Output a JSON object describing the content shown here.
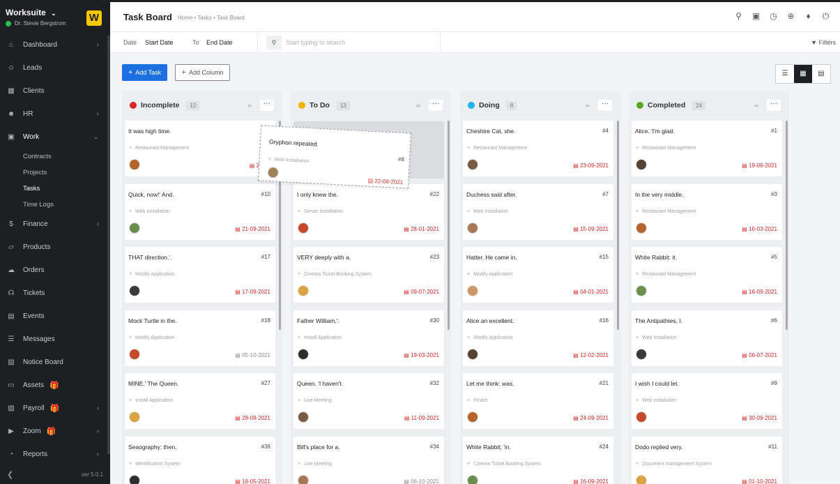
{
  "app": {
    "name": "Worksuite",
    "user": "Dr. Stevie Bergstrom",
    "logo_letter": "W",
    "version": "ver 5.0.1"
  },
  "sidebar": {
    "items": [
      {
        "label": "Dashboard",
        "icon": "home-icon",
        "has_chevron": true
      },
      {
        "label": "Leads",
        "icon": "user-icon",
        "has_chevron": false
      },
      {
        "label": "Clients",
        "icon": "building-icon",
        "has_chevron": false
      },
      {
        "label": "HR",
        "icon": "users-icon",
        "has_chevron": true
      },
      {
        "label": "Work",
        "icon": "briefcase-icon",
        "has_chevron": true,
        "expanded": true
      },
      {
        "label": "Finance",
        "icon": "dollar-icon",
        "has_chevron": true
      },
      {
        "label": "Products",
        "icon": "basket-icon",
        "has_chevron": false
      },
      {
        "label": "Orders",
        "icon": "cart-icon",
        "has_chevron": false
      },
      {
        "label": "Tickets",
        "icon": "headset-icon",
        "has_chevron": false
      },
      {
        "label": "Events",
        "icon": "calendar-icon",
        "has_chevron": false
      },
      {
        "label": "Messages",
        "icon": "message-icon",
        "has_chevron": false
      },
      {
        "label": "Notice Board",
        "icon": "clipboard-icon",
        "has_chevron": false
      },
      {
        "label": "Assets",
        "icon": "monitor-icon",
        "has_chevron": false,
        "gift": true
      },
      {
        "label": "Payroll",
        "icon": "wallet-icon",
        "has_chevron": true,
        "gift": true
      },
      {
        "label": "Zoom",
        "icon": "video-icon",
        "has_chevron": true,
        "gift": true
      },
      {
        "label": "Reports",
        "icon": "pie-chart-icon",
        "has_chevron": true
      }
    ],
    "work_sub": [
      {
        "label": "Contracts"
      },
      {
        "label": "Projects"
      },
      {
        "label": "Tasks",
        "active": true
      },
      {
        "label": "Time Logs"
      }
    ]
  },
  "header": {
    "title": "Task Board",
    "breadcrumb": "Home • Tasks • Task Board"
  },
  "filters": {
    "date_label": "Date",
    "start": "Start Date",
    "to": "To",
    "end": "End Date",
    "search_placeholder": "Start typing to search",
    "filters_label": "Filters"
  },
  "actions": {
    "add_task": "Add Task",
    "add_column": "Add Column"
  },
  "columns": [
    {
      "title": "Incomplete",
      "count": "12",
      "color": "#d62828",
      "cards": [
        {
          "title": "It was high time.",
          "num": "",
          "project": "Restaurant Management",
          "date": "24-09",
          "overdue": true
        },
        {
          "title": "Quick, now!' And.",
          "num": "#10",
          "project": "Web Installation",
          "date": "21-09-2021",
          "overdue": true
        },
        {
          "title": "THAT direction,'.",
          "num": "#17",
          "project": "Modify Application",
          "date": "17-09-2021",
          "overdue": true
        },
        {
          "title": "Mock Turtle in the.",
          "num": "#18",
          "project": "Modify Application",
          "date": "05-10-2021",
          "overdue": false
        },
        {
          "title": "MINE.' The Queen.",
          "num": "#27",
          "project": "Install Application",
          "date": "28-09-2021",
          "overdue": true
        },
        {
          "title": "Seaography: then.",
          "num": "#36",
          "project": "Identification System",
          "date": "18-05-2021",
          "overdue": true
        }
      ]
    },
    {
      "title": "To Do",
      "count": "13",
      "color": "#f0b400",
      "cards": [
        {
          "title": "I only knew the.",
          "num": "#22",
          "project": "Server Installation",
          "date": "28-01-2021",
          "overdue": true
        },
        {
          "title": "VERY deeply with a.",
          "num": "#23",
          "project": "Cinema Ticket Booking System",
          "date": "09-07-2021",
          "overdue": true
        },
        {
          "title": "Father William,'.",
          "num": "#30",
          "project": "Install Application",
          "date": "19-03-2021",
          "overdue": true
        },
        {
          "title": "Queen. 'I haven't.",
          "num": "#32",
          "project": "Live Meeting",
          "date": "11-09-2021",
          "overdue": true
        },
        {
          "title": "Bill's place for a.",
          "num": "#34",
          "project": "Live Meeting",
          "date": "06-10-2021",
          "overdue": false
        }
      ]
    },
    {
      "title": "Doing",
      "count": "8",
      "color": "#1cb3f0",
      "cards": [
        {
          "title": "Cheshire Cat, she.",
          "num": "#4",
          "project": "Restaurant Management",
          "date": "23-09-2021",
          "overdue": true
        },
        {
          "title": "Duchess said after.",
          "num": "#7",
          "project": "Web Installation",
          "date": "15-09-2021",
          "overdue": true
        },
        {
          "title": "Hatter. He came in.",
          "num": "#15",
          "project": "Modify Application",
          "date": "04-01-2021",
          "overdue": true
        },
        {
          "title": "Alice an excellent.",
          "num": "#16",
          "project": "Modify Application",
          "date": "12-02-2021",
          "overdue": true
        },
        {
          "title": "Let me think: was.",
          "num": "#21",
          "project": "Picard",
          "date": "24-09-2021",
          "overdue": true
        },
        {
          "title": "White Rabbit; 'in.",
          "num": "#24",
          "project": "Cinema Ticket Booking System",
          "date": "16-09-2021",
          "overdue": true
        }
      ]
    },
    {
      "title": "Completed",
      "count": "24",
      "color": "#5aa61e",
      "cards": [
        {
          "title": "Alice. 'I'm glad.",
          "num": "#1",
          "project": "Restaurant Management",
          "date": "19-06-2021",
          "overdue": true
        },
        {
          "title": "In the very middle.",
          "num": "#3",
          "project": "Restaurant Management",
          "date": "16-03-2021",
          "overdue": true
        },
        {
          "title": "White Rabbit: it.",
          "num": "#5",
          "project": "Restaurant Management",
          "date": "16-09-2021",
          "overdue": true
        },
        {
          "title": "The Antipathies, I.",
          "num": "#6",
          "project": "Web Installation",
          "date": "06-07-2021",
          "overdue": true
        },
        {
          "title": "I wish I could let.",
          "num": "#9",
          "project": "Web Installation",
          "date": "30-09-2021",
          "overdue": true
        },
        {
          "title": "Dodo replied very.",
          "num": "#11",
          "project": "Document management System",
          "date": "01-10-2021",
          "overdue": true
        }
      ]
    }
  ],
  "dragging": {
    "title": "Gryphon repeated.",
    "num": "#8",
    "project": "Web Installation",
    "date": "22-09-2021"
  }
}
